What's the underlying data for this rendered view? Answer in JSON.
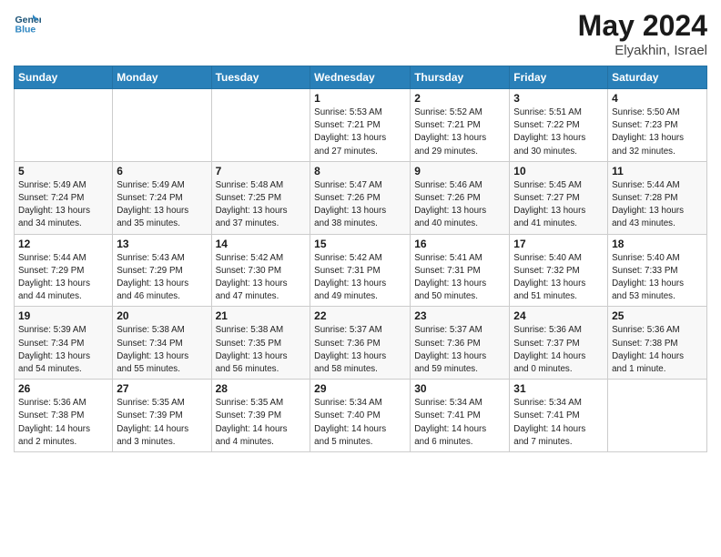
{
  "logo": {
    "text_general": "General",
    "text_blue": "Blue"
  },
  "title": "May 2024",
  "location": "Elyakhin, Israel",
  "days_of_week": [
    "Sunday",
    "Monday",
    "Tuesday",
    "Wednesday",
    "Thursday",
    "Friday",
    "Saturday"
  ],
  "weeks": [
    [
      {
        "day": "",
        "info": ""
      },
      {
        "day": "",
        "info": ""
      },
      {
        "day": "",
        "info": ""
      },
      {
        "day": "1",
        "info": "Sunrise: 5:53 AM\nSunset: 7:21 PM\nDaylight: 13 hours\nand 27 minutes."
      },
      {
        "day": "2",
        "info": "Sunrise: 5:52 AM\nSunset: 7:21 PM\nDaylight: 13 hours\nand 29 minutes."
      },
      {
        "day": "3",
        "info": "Sunrise: 5:51 AM\nSunset: 7:22 PM\nDaylight: 13 hours\nand 30 minutes."
      },
      {
        "day": "4",
        "info": "Sunrise: 5:50 AM\nSunset: 7:23 PM\nDaylight: 13 hours\nand 32 minutes."
      }
    ],
    [
      {
        "day": "5",
        "info": "Sunrise: 5:49 AM\nSunset: 7:24 PM\nDaylight: 13 hours\nand 34 minutes."
      },
      {
        "day": "6",
        "info": "Sunrise: 5:49 AM\nSunset: 7:24 PM\nDaylight: 13 hours\nand 35 minutes."
      },
      {
        "day": "7",
        "info": "Sunrise: 5:48 AM\nSunset: 7:25 PM\nDaylight: 13 hours\nand 37 minutes."
      },
      {
        "day": "8",
        "info": "Sunrise: 5:47 AM\nSunset: 7:26 PM\nDaylight: 13 hours\nand 38 minutes."
      },
      {
        "day": "9",
        "info": "Sunrise: 5:46 AM\nSunset: 7:26 PM\nDaylight: 13 hours\nand 40 minutes."
      },
      {
        "day": "10",
        "info": "Sunrise: 5:45 AM\nSunset: 7:27 PM\nDaylight: 13 hours\nand 41 minutes."
      },
      {
        "day": "11",
        "info": "Sunrise: 5:44 AM\nSunset: 7:28 PM\nDaylight: 13 hours\nand 43 minutes."
      }
    ],
    [
      {
        "day": "12",
        "info": "Sunrise: 5:44 AM\nSunset: 7:29 PM\nDaylight: 13 hours\nand 44 minutes."
      },
      {
        "day": "13",
        "info": "Sunrise: 5:43 AM\nSunset: 7:29 PM\nDaylight: 13 hours\nand 46 minutes."
      },
      {
        "day": "14",
        "info": "Sunrise: 5:42 AM\nSunset: 7:30 PM\nDaylight: 13 hours\nand 47 minutes."
      },
      {
        "day": "15",
        "info": "Sunrise: 5:42 AM\nSunset: 7:31 PM\nDaylight: 13 hours\nand 49 minutes."
      },
      {
        "day": "16",
        "info": "Sunrise: 5:41 AM\nSunset: 7:31 PM\nDaylight: 13 hours\nand 50 minutes."
      },
      {
        "day": "17",
        "info": "Sunrise: 5:40 AM\nSunset: 7:32 PM\nDaylight: 13 hours\nand 51 minutes."
      },
      {
        "day": "18",
        "info": "Sunrise: 5:40 AM\nSunset: 7:33 PM\nDaylight: 13 hours\nand 53 minutes."
      }
    ],
    [
      {
        "day": "19",
        "info": "Sunrise: 5:39 AM\nSunset: 7:34 PM\nDaylight: 13 hours\nand 54 minutes."
      },
      {
        "day": "20",
        "info": "Sunrise: 5:38 AM\nSunset: 7:34 PM\nDaylight: 13 hours\nand 55 minutes."
      },
      {
        "day": "21",
        "info": "Sunrise: 5:38 AM\nSunset: 7:35 PM\nDaylight: 13 hours\nand 56 minutes."
      },
      {
        "day": "22",
        "info": "Sunrise: 5:37 AM\nSunset: 7:36 PM\nDaylight: 13 hours\nand 58 minutes."
      },
      {
        "day": "23",
        "info": "Sunrise: 5:37 AM\nSunset: 7:36 PM\nDaylight: 13 hours\nand 59 minutes."
      },
      {
        "day": "24",
        "info": "Sunrise: 5:36 AM\nSunset: 7:37 PM\nDaylight: 14 hours\nand 0 minutes."
      },
      {
        "day": "25",
        "info": "Sunrise: 5:36 AM\nSunset: 7:38 PM\nDaylight: 14 hours\nand 1 minute."
      }
    ],
    [
      {
        "day": "26",
        "info": "Sunrise: 5:36 AM\nSunset: 7:38 PM\nDaylight: 14 hours\nand 2 minutes."
      },
      {
        "day": "27",
        "info": "Sunrise: 5:35 AM\nSunset: 7:39 PM\nDaylight: 14 hours\nand 3 minutes."
      },
      {
        "day": "28",
        "info": "Sunrise: 5:35 AM\nSunset: 7:39 PM\nDaylight: 14 hours\nand 4 minutes."
      },
      {
        "day": "29",
        "info": "Sunrise: 5:34 AM\nSunset: 7:40 PM\nDaylight: 14 hours\nand 5 minutes."
      },
      {
        "day": "30",
        "info": "Sunrise: 5:34 AM\nSunset: 7:41 PM\nDaylight: 14 hours\nand 6 minutes."
      },
      {
        "day": "31",
        "info": "Sunrise: 5:34 AM\nSunset: 7:41 PM\nDaylight: 14 hours\nand 7 minutes."
      },
      {
        "day": "",
        "info": ""
      }
    ]
  ]
}
